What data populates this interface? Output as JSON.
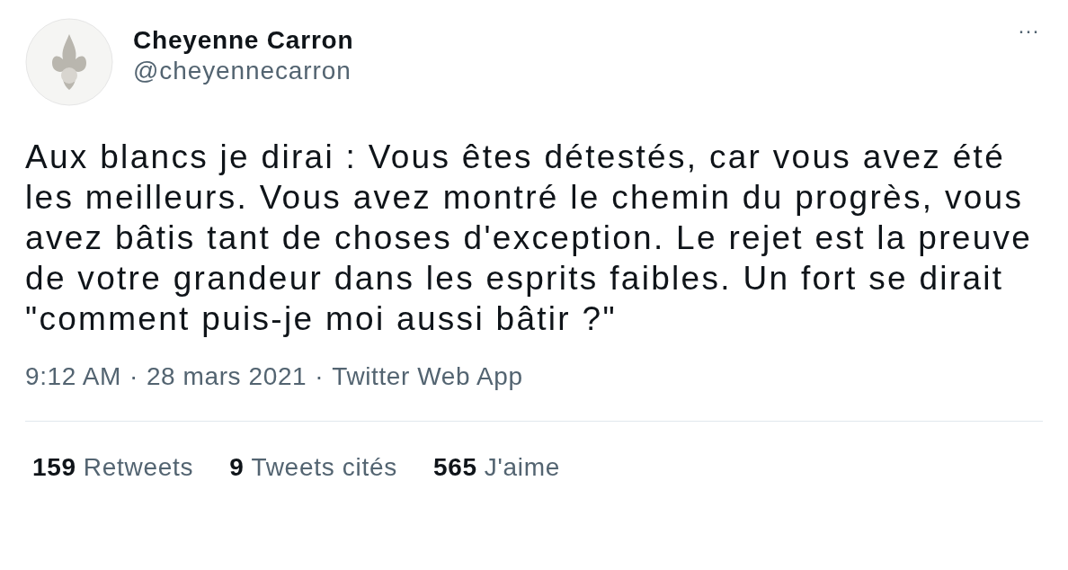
{
  "author": {
    "name": "Cheyenne Carron",
    "handle": "@cheyennecarron"
  },
  "more": "···",
  "text": "Aux blancs je dirai : Vous êtes détestés, car vous avez été les meilleurs. Vous avez montré le chemin du progrès, vous avez bâtis tant de choses d'exception. Le rejet est la preuve de votre grandeur dans les esprits faibles. Un fort se dirait \"comment puis-je moi aussi bâtir ?\"",
  "meta": [
    "9:12 AM",
    "·",
    "28 mars 2021",
    "·",
    "Twitter Web App"
  ],
  "stats": [
    {
      "count": "159",
      "label": "Retweets"
    },
    {
      "count": "9",
      "label": "Tweets cités"
    },
    {
      "count": "565",
      "label": "J'aime"
    }
  ]
}
